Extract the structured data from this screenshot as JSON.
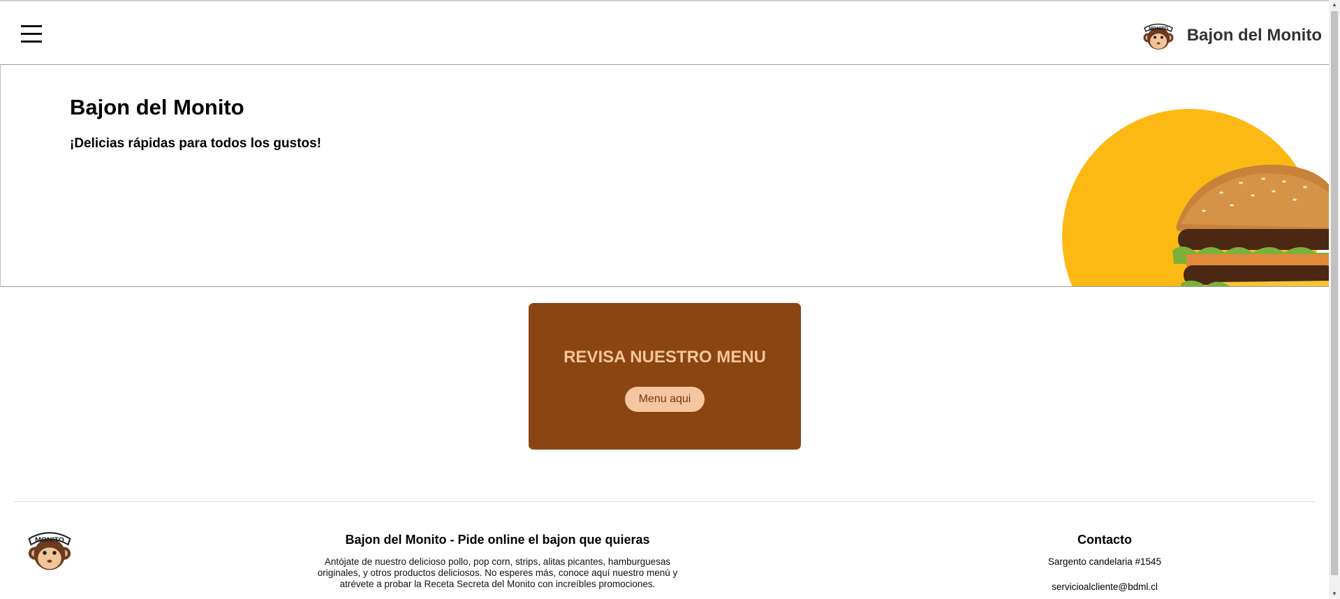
{
  "header": {
    "menu_icon": "hamburger-menu-icon",
    "brand_name": "Bajon del Monito",
    "logo_text": "MONITO"
  },
  "hero": {
    "title": "Bajon del Monito",
    "subtitle": "¡Delicias rápidas para todos los gustos!",
    "circle_color": "#FDB913"
  },
  "promo": {
    "title": "REVISA NUESTRO MENU",
    "button_label": "Menu aqui",
    "background_color": "#8B4513"
  },
  "footer": {
    "about_title": "Bajon del Monito - Pide online el bajon que quieras",
    "about_text": "Antójate de nuestro delicioso pollo, pop corn, strips, alitas picantes, hamburguesas originales, y otros productos deliciosos. No esperes más, conoce aquí nuestro menú y atrévete a probar la Receta Secreta del Monito con increíbles promociones.",
    "contact_title": "Contacto",
    "address": "Sargento candelaria #1545",
    "email": "servicioalcliente@bdml.cl"
  }
}
